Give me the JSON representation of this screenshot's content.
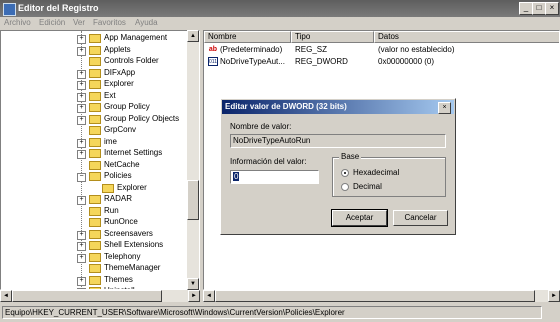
{
  "window": {
    "title": "Editor del Registro",
    "min": "_",
    "max": "□",
    "close": "×"
  },
  "menu": [
    "Archivo",
    "Edición",
    "Ver",
    "Favoritos",
    "Ayuda"
  ],
  "tree": {
    "items": [
      {
        "label": "App Management",
        "expander": "+"
      },
      {
        "label": "Applets",
        "expander": "+"
      },
      {
        "label": "Controls Folder",
        "expander": ""
      },
      {
        "label": "DIFxApp",
        "expander": "+"
      },
      {
        "label": "Explorer",
        "expander": "+"
      },
      {
        "label": "Ext",
        "expander": "+"
      },
      {
        "label": "Group Policy",
        "expander": "+"
      },
      {
        "label": "Group Policy Objects",
        "expander": "+"
      },
      {
        "label": "GrpConv",
        "expander": ""
      },
      {
        "label": "ime",
        "expander": "+"
      },
      {
        "label": "Internet Settings",
        "expander": "+"
      },
      {
        "label": "NetCache",
        "expander": ""
      },
      {
        "label": "Policies",
        "expander": "−"
      },
      {
        "label": "Explorer",
        "expander": ""
      },
      {
        "label": "RADAR",
        "expander": "+"
      },
      {
        "label": "Run",
        "expander": ""
      },
      {
        "label": "RunOnce",
        "expander": ""
      },
      {
        "label": "Screensavers",
        "expander": "+"
      },
      {
        "label": "Shell Extensions",
        "expander": "+"
      },
      {
        "label": "Telephony",
        "expander": "+"
      },
      {
        "label": "ThemeManager",
        "expander": ""
      },
      {
        "label": "Themes",
        "expander": "+"
      },
      {
        "label": "Uninstall",
        "expander": "+"
      }
    ]
  },
  "list": {
    "columns": [
      "Nombre",
      "Tipo",
      "Datos"
    ],
    "rows": [
      {
        "icon": "ab",
        "name": "(Predeterminado)",
        "type": "REG_SZ",
        "data": "(valor no establecido)"
      },
      {
        "icon": "011",
        "name": "NoDriveTypeAut...",
        "type": "REG_DWORD",
        "data": "0x00000000 (0)"
      }
    ]
  },
  "status": {
    "path": "Equipo\\HKEY_CURRENT_USER\\Software\\Microsoft\\Windows\\CurrentVersion\\Policies\\Explorer"
  },
  "dialog": {
    "title": "Editar valor de DWORD (32 bits)",
    "close": "×",
    "name_label": "Nombre de valor:",
    "name_value": "NoDriveTypeAutoRun",
    "data_label": "Información del valor:",
    "data_value": "0",
    "base_label": "Base",
    "hex_label": "Hexadecimal",
    "dec_label": "Decimal",
    "base_selected": "Hexadecimal",
    "ok_label": "Aceptar",
    "cancel_label": "Cancelar"
  },
  "scroll": {
    "up": "▲",
    "down": "▼",
    "left": "◄",
    "right": "►"
  }
}
